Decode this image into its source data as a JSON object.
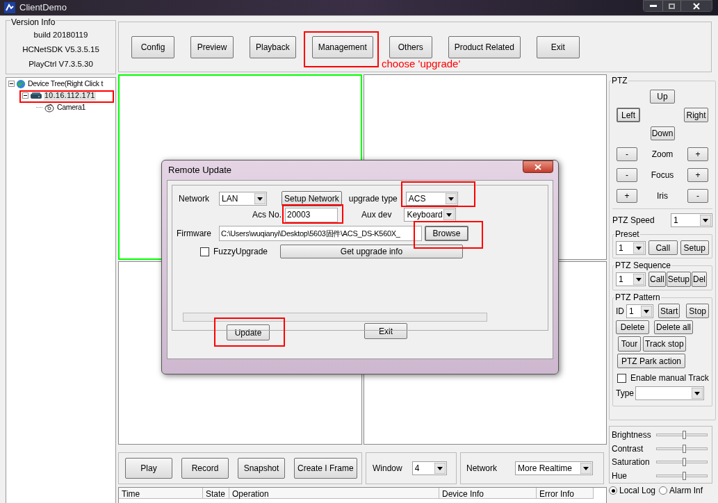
{
  "window": {
    "title": "ClientDemo"
  },
  "version_info": {
    "title": "Version Info",
    "lines": [
      "build 20180119",
      "HCNetSDK V5.3.5.15",
      "PlayCtrl V7.3.5.30"
    ]
  },
  "toolbar": [
    {
      "label": "Config"
    },
    {
      "label": "Preview"
    },
    {
      "label": "Playback"
    },
    {
      "label": "Management"
    },
    {
      "label": "Others"
    },
    {
      "label": "Product Related"
    },
    {
      "label": "Exit"
    }
  ],
  "annotation": "choose 'upgrade'",
  "device_tree": [
    {
      "kind": "root",
      "label": "Device Tree(Right Click t",
      "expanded": true,
      "selected": false,
      "children": [
        {
          "kind": "device",
          "label": "10.16.112.171",
          "expanded": true,
          "selected": true,
          "children": [
            {
              "kind": "camera",
              "label": "Camera1",
              "selected": false
            }
          ]
        }
      ]
    }
  ],
  "video_windows": [
    {
      "selected": true
    },
    {
      "selected": false
    },
    {
      "selected": false
    },
    {
      "selected": false
    }
  ],
  "ptz": {
    "title": "PTZ",
    "up": "Up",
    "left": "Left",
    "right": "Right",
    "down": "Down",
    "rows": [
      {
        "label": "Zoom",
        "left": "-",
        "right": "+"
      },
      {
        "label": "Focus",
        "left": "-",
        "right": "+"
      },
      {
        "label": "Iris",
        "left": "+",
        "right": "-"
      }
    ],
    "speed_label": "PTZ Speed",
    "speed": "1",
    "preset": {
      "title": "Preset",
      "value": "1",
      "buttons": [
        "Call",
        "Setup"
      ]
    },
    "sequence": {
      "title": "PTZ Sequence",
      "value": "1",
      "buttons": [
        "Call",
        "Setup",
        "Del"
      ]
    },
    "pattern": {
      "title": "PTZ Pattern",
      "id_label": "ID",
      "id": "1",
      "start": "Start",
      "stop": "Stop",
      "delete": "Delete",
      "delete_all": "Delete all",
      "tour": "Tour",
      "track_stop": "Track stop",
      "park": "PTZ Park action",
      "manual_track": {
        "label": "Enable manual Track",
        "checked": false
      },
      "type_label": "Type"
    }
  },
  "image": [
    {
      "label": "Brightness",
      "level": 0.55
    },
    {
      "label": "Contrast",
      "level": 0.55
    },
    {
      "label": "Saturation",
      "level": 0.55
    },
    {
      "label": "Hue",
      "level": 0.55
    }
  ],
  "log_tabs": [
    {
      "label": "Local Log",
      "selected": true
    },
    {
      "label": "Alarm Inf",
      "selected": false
    }
  ],
  "play_buttons": [
    "Play",
    "Record",
    "Snapshot",
    "Create I Frame"
  ],
  "window_select": {
    "label": "Window",
    "value": "4"
  },
  "network_select": {
    "label": "Network",
    "value": "More Realtime"
  },
  "log": {
    "columns": [
      "Time",
      "State",
      "Operation",
      "Device Info",
      "Error Info"
    ]
  },
  "dialog": {
    "title": "Remote Update",
    "network_label": "Network",
    "network": "LAN",
    "setup_network": "Setup Network",
    "upgrade_type_label": "upgrade type",
    "upgrade_type": "ACS",
    "acs_label": "Acs No.",
    "acs": "20003",
    "aux_label": "Aux dev",
    "aux": "Keyboard",
    "firmware_label": "Firmware",
    "firmware": "C:\\Users\\wuqianyi\\Desktop\\5603固件\\ACS_DS-K560X_",
    "browse": "Browse",
    "fuzzy": {
      "label": "FuzzyUpgrade",
      "checked": false
    },
    "get_info": "Get upgrade info",
    "level": 0,
    "update": "Update",
    "exit": "Exit"
  }
}
